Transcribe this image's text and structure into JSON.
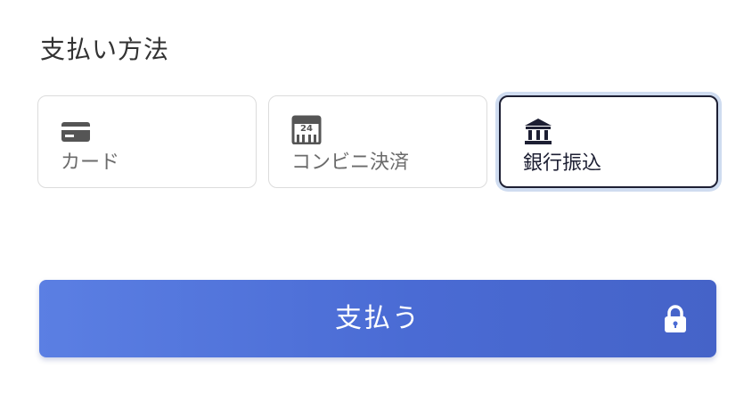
{
  "payment": {
    "title": "支払い方法",
    "methods": [
      {
        "label": "カード",
        "icon": "credit-card-icon",
        "selected": false
      },
      {
        "label": "コンビニ決済",
        "icon": "convenience-store-24-icon",
        "selected": false
      },
      {
        "label": "銀行振込",
        "icon": "bank-icon",
        "selected": true
      }
    ],
    "pay_button": {
      "label": "支払う",
      "icon": "lock-icon"
    }
  },
  "colors": {
    "selected_border": "#1d1f33",
    "selected_ring": "#cfdcf0",
    "button_gradient_start": "#5b7fe3",
    "button_gradient_end": "#4563c8"
  }
}
